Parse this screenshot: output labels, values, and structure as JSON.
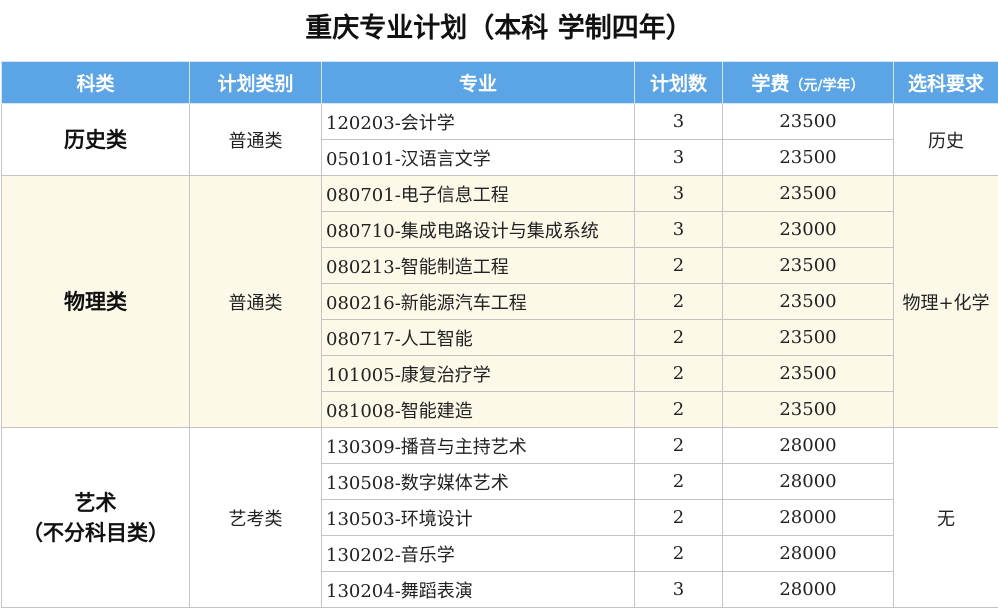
{
  "title": "重庆专业计划（本科 学制四年）",
  "headers": {
    "category": "科类",
    "plan_type": "计划类别",
    "major": "专业",
    "plan_count": "计划数",
    "tuition": "学费",
    "tuition_unit": "（元/学年）",
    "subject_req": "选科要求"
  },
  "groups": [
    {
      "category_lines": [
        "历史类"
      ],
      "plan_type": "普通类",
      "subject_req": "历史",
      "rows": [
        {
          "major": "120203-会计学",
          "count": "3",
          "tuition": "23500"
        },
        {
          "major": "050101-汉语言文学",
          "count": "3",
          "tuition": "23500"
        }
      ]
    },
    {
      "category_lines": [
        "物理类"
      ],
      "plan_type": "普通类",
      "subject_req": "物理+化学",
      "rows": [
        {
          "major": "080701-电子信息工程",
          "count": "3",
          "tuition": "23500"
        },
        {
          "major": "080710-集成电路设计与集成系统",
          "count": "3",
          "tuition": "23000"
        },
        {
          "major": "080213-智能制造工程",
          "count": "2",
          "tuition": "23500"
        },
        {
          "major": "080216-新能源汽车工程",
          "count": "2",
          "tuition": "23500"
        },
        {
          "major": "080717-人工智能",
          "count": "2",
          "tuition": "23500"
        },
        {
          "major": "101005-康复治疗学",
          "count": "2",
          "tuition": "23500"
        },
        {
          "major": "081008-智能建造",
          "count": "2",
          "tuition": "23500"
        }
      ]
    },
    {
      "category_lines": [
        "艺术",
        "（不分科目类）"
      ],
      "plan_type": "艺考类",
      "subject_req": "无",
      "rows": [
        {
          "major": "130309-播音与主持艺术",
          "count": "2",
          "tuition": "28000"
        },
        {
          "major": "130508-数字媒体艺术",
          "count": "2",
          "tuition": "28000"
        },
        {
          "major": "130503-环境设计",
          "count": "2",
          "tuition": "28000"
        },
        {
          "major": "130202-音乐学",
          "count": "2",
          "tuition": "28000"
        },
        {
          "major": "130204-舞蹈表演",
          "count": "3",
          "tuition": "28000"
        }
      ]
    }
  ]
}
